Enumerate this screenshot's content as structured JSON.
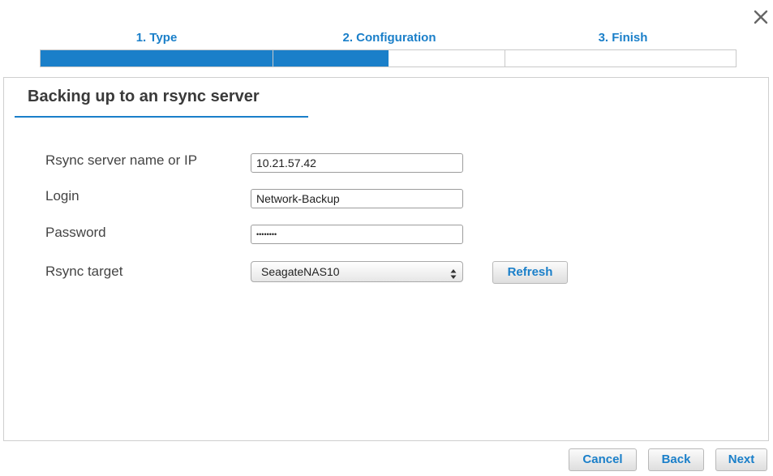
{
  "wizard": {
    "close_icon": "close-icon",
    "steps": [
      {
        "label": "1. Type",
        "progress": 1.0
      },
      {
        "label": "2. Configuration",
        "progress": 0.5
      },
      {
        "label": "3. Finish",
        "progress": 0.0
      }
    ],
    "accent_color": "#1a7fc9"
  },
  "panel": {
    "title": "Backing up to an rsync server",
    "fields": {
      "server": {
        "label": "Rsync server name or IP",
        "value": "10.21.57.42"
      },
      "login": {
        "label": "Login",
        "value": "Network-Backup"
      },
      "password": {
        "label": "Password",
        "value": "••••••••"
      },
      "target": {
        "label": "Rsync target",
        "value": "SeagateNAS10",
        "icon": "select-updown-icon"
      }
    },
    "refresh_label": "Refresh"
  },
  "footer": {
    "cancel_label": "Cancel",
    "back_label": "Back",
    "next_label": "Next"
  }
}
